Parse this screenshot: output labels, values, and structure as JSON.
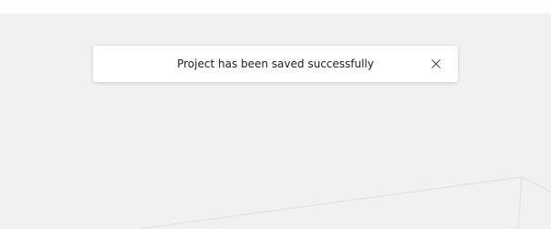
{
  "toast": {
    "message": "Project has been saved successfully",
    "close_icon": "close-icon"
  },
  "colors": {
    "background": "#f1f1f1",
    "topbar": "#ffffff",
    "toast_background": "#ffffff",
    "text": "#202020",
    "canvas_lines": "#dedede"
  }
}
